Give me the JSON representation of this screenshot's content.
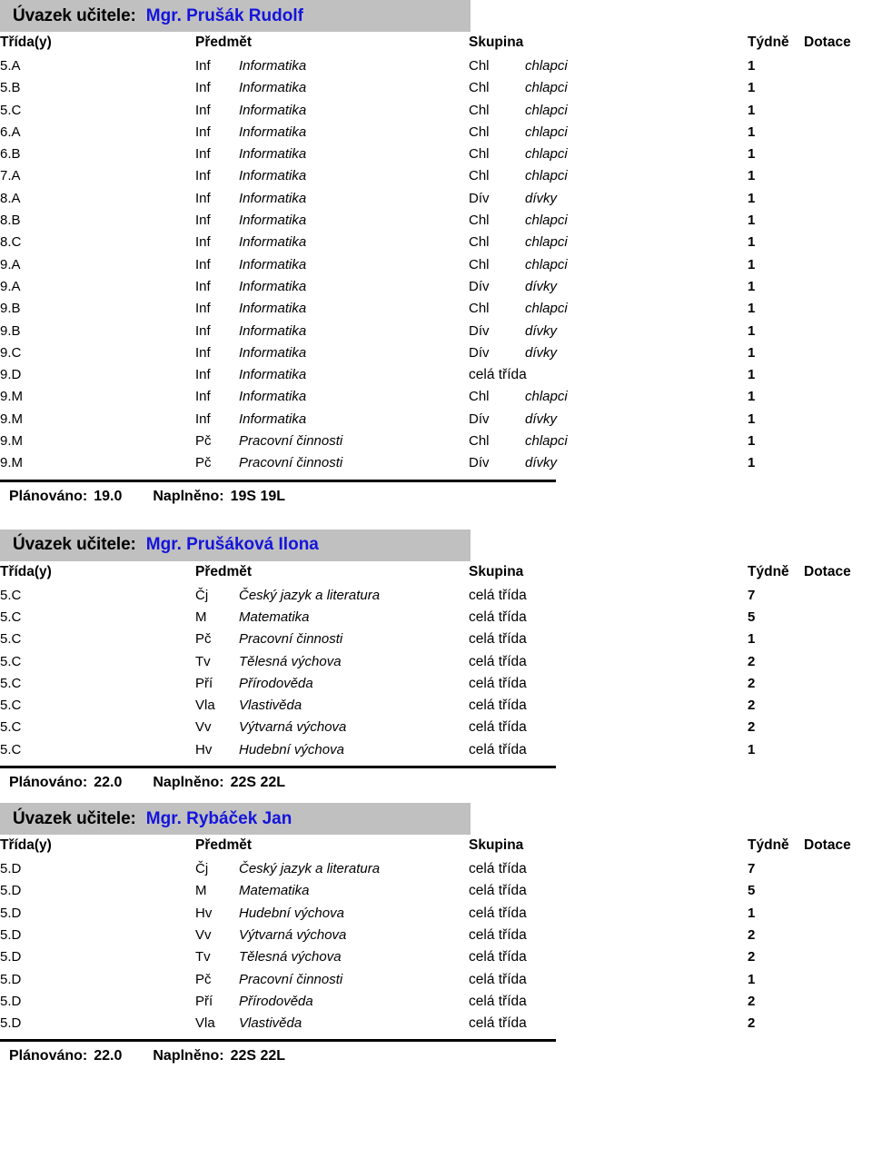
{
  "headers": {
    "class": "Třída(y)",
    "subject": "Předmět",
    "group": "Skupina",
    "week": "Týdně",
    "allocation": "Dotace"
  },
  "teacher_label": "Úvazek učitele:",
  "totals_labels": {
    "planned": "Plánováno:",
    "filled": "Naplněno:"
  },
  "colors": {
    "band_background": "#c0c0c0",
    "teacher_name": "#1414dc",
    "text": "#000000",
    "separator": "#000000"
  },
  "sections": [
    {
      "teacher": "Mgr. Prušák Rudolf",
      "rows": [
        {
          "class": "5.A",
          "abbr": "Inf",
          "subject": "Informatika",
          "group_abbr": "Chl",
          "group_full": "chlapci",
          "week": "1",
          "allocation": ""
        },
        {
          "class": "5.B",
          "abbr": "Inf",
          "subject": "Informatika",
          "group_abbr": "Chl",
          "group_full": "chlapci",
          "week": "1",
          "allocation": ""
        },
        {
          "class": "5.C",
          "abbr": "Inf",
          "subject": "Informatika",
          "group_abbr": "Chl",
          "group_full": "chlapci",
          "week": "1",
          "allocation": ""
        },
        {
          "class": "6.A",
          "abbr": "Inf",
          "subject": "Informatika",
          "group_abbr": "Chl",
          "group_full": "chlapci",
          "week": "1",
          "allocation": ""
        },
        {
          "class": "6.B",
          "abbr": "Inf",
          "subject": "Informatika",
          "group_abbr": "Chl",
          "group_full": "chlapci",
          "week": "1",
          "allocation": ""
        },
        {
          "class": "7.A",
          "abbr": "Inf",
          "subject": "Informatika",
          "group_abbr": "Chl",
          "group_full": "chlapci",
          "week": "1",
          "allocation": ""
        },
        {
          "class": "8.A",
          "abbr": "Inf",
          "subject": "Informatika",
          "group_abbr": "Dív",
          "group_full": "dívky",
          "week": "1",
          "allocation": ""
        },
        {
          "class": "8.B",
          "abbr": "Inf",
          "subject": "Informatika",
          "group_abbr": "Chl",
          "group_full": "chlapci",
          "week": "1",
          "allocation": ""
        },
        {
          "class": "8.C",
          "abbr": "Inf",
          "subject": "Informatika",
          "group_abbr": "Chl",
          "group_full": "chlapci",
          "week": "1",
          "allocation": ""
        },
        {
          "class": "9.A",
          "abbr": "Inf",
          "subject": "Informatika",
          "group_abbr": "Chl",
          "group_full": "chlapci",
          "week": "1",
          "allocation": ""
        },
        {
          "class": "9.A",
          "abbr": "Inf",
          "subject": "Informatika",
          "group_abbr": "Dív",
          "group_full": "dívky",
          "week": "1",
          "allocation": ""
        },
        {
          "class": "9.B",
          "abbr": "Inf",
          "subject": "Informatika",
          "group_abbr": "Chl",
          "group_full": "chlapci",
          "week": "1",
          "allocation": ""
        },
        {
          "class": "9.B",
          "abbr": "Inf",
          "subject": "Informatika",
          "group_abbr": "Dív",
          "group_full": "dívky",
          "week": "1",
          "allocation": ""
        },
        {
          "class": "9.C",
          "abbr": "Inf",
          "subject": "Informatika",
          "group_abbr": "Dív",
          "group_full": "dívky",
          "week": "1",
          "allocation": ""
        },
        {
          "class": "9.D",
          "abbr": "Inf",
          "subject": "Informatika",
          "group_abbr": "celá třída",
          "group_full": "",
          "week": "1",
          "allocation": ""
        },
        {
          "class": "9.M",
          "abbr": "Inf",
          "subject": "Informatika",
          "group_abbr": "Chl",
          "group_full": "chlapci",
          "week": "1",
          "allocation": ""
        },
        {
          "class": "9.M",
          "abbr": "Inf",
          "subject": "Informatika",
          "group_abbr": "Dív",
          "group_full": "dívky",
          "week": "1",
          "allocation": ""
        },
        {
          "class": "9.M",
          "abbr": "Pč",
          "subject": "Pracovní činnosti",
          "group_abbr": "Chl",
          "group_full": "chlapci",
          "week": "1",
          "allocation": ""
        },
        {
          "class": "9.M",
          "abbr": "Pč",
          "subject": "Pracovní činnosti",
          "group_abbr": "Dív",
          "group_full": "dívky",
          "week": "1",
          "allocation": ""
        }
      ],
      "planned": "19.0",
      "filled": "19S 19L"
    },
    {
      "teacher": "Mgr. Prušáková Ilona",
      "rows": [
        {
          "class": "5.C",
          "abbr": "Čj",
          "subject": "Český jazyk a literatura",
          "group_abbr": "celá třída",
          "group_full": "",
          "week": "7",
          "allocation": ""
        },
        {
          "class": "5.C",
          "abbr": "M",
          "subject": "Matematika",
          "group_abbr": "celá třída",
          "group_full": "",
          "week": "5",
          "allocation": ""
        },
        {
          "class": "5.C",
          "abbr": "Pč",
          "subject": "Pracovní činnosti",
          "group_abbr": "celá třída",
          "group_full": "",
          "week": "1",
          "allocation": ""
        },
        {
          "class": "5.C",
          "abbr": "Tv",
          "subject": "Tělesná výchova",
          "group_abbr": "celá třída",
          "group_full": "",
          "week": "2",
          "allocation": ""
        },
        {
          "class": "5.C",
          "abbr": "Pří",
          "subject": "Přírodověda",
          "group_abbr": "celá třída",
          "group_full": "",
          "week": "2",
          "allocation": ""
        },
        {
          "class": "5.C",
          "abbr": "Vla",
          "subject": "Vlastivěda",
          "group_abbr": "celá třída",
          "group_full": "",
          "week": "2",
          "allocation": ""
        },
        {
          "class": "5.C",
          "abbr": "Vv",
          "subject": "Výtvarná výchova",
          "group_abbr": "celá třída",
          "group_full": "",
          "week": "2",
          "allocation": ""
        },
        {
          "class": "5.C",
          "abbr": "Hv",
          "subject": "Hudební výchova",
          "group_abbr": "celá třída",
          "group_full": "",
          "week": "1",
          "allocation": ""
        }
      ],
      "planned": "22.0",
      "filled": "22S 22L"
    },
    {
      "teacher": "Mgr. Rybáček Jan",
      "rows": [
        {
          "class": "5.D",
          "abbr": "Čj",
          "subject": "Český jazyk a literatura",
          "group_abbr": "celá třída",
          "group_full": "",
          "week": "7",
          "allocation": ""
        },
        {
          "class": "5.D",
          "abbr": "M",
          "subject": "Matematika",
          "group_abbr": "celá třída",
          "group_full": "",
          "week": "5",
          "allocation": ""
        },
        {
          "class": "5.D",
          "abbr": "Hv",
          "subject": "Hudební výchova",
          "group_abbr": "celá třída",
          "group_full": "",
          "week": "1",
          "allocation": ""
        },
        {
          "class": "5.D",
          "abbr": "Vv",
          "subject": "Výtvarná výchova",
          "group_abbr": "celá třída",
          "group_full": "",
          "week": "2",
          "allocation": ""
        },
        {
          "class": "5.D",
          "abbr": "Tv",
          "subject": "Tělesná výchova",
          "group_abbr": "celá třída",
          "group_full": "",
          "week": "2",
          "allocation": ""
        },
        {
          "class": "5.D",
          "abbr": "Pč",
          "subject": "Pracovní činnosti",
          "group_abbr": "celá třída",
          "group_full": "",
          "week": "1",
          "allocation": ""
        },
        {
          "class": "5.D",
          "abbr": "Pří",
          "subject": "Přírodověda",
          "group_abbr": "celá třída",
          "group_full": "",
          "week": "2",
          "allocation": ""
        },
        {
          "class": "5.D",
          "abbr": "Vla",
          "subject": "Vlastivěda",
          "group_abbr": "celá třída",
          "group_full": "",
          "week": "2",
          "allocation": ""
        }
      ],
      "planned": "22.0",
      "filled": "22S 22L"
    }
  ]
}
